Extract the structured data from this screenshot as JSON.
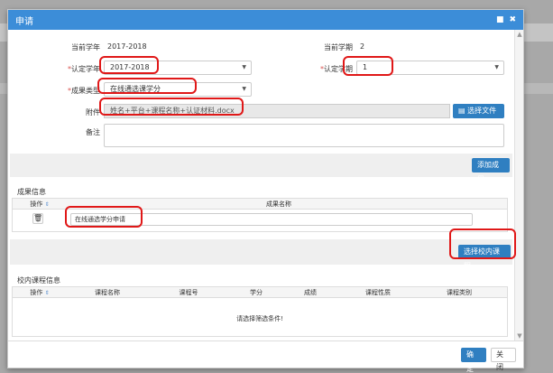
{
  "dialog": {
    "title": "申请",
    "min_label": "■",
    "close_label": "✖"
  },
  "form": {
    "current_year_label": "当前学年",
    "current_year_value": "2017-2018",
    "current_term_label": "当前学期",
    "current_term_value": "2",
    "cert_year_label": "认定学年",
    "cert_year_value": "2017-2018",
    "cert_term_label": "认定学期",
    "cert_term_value": "1",
    "type_label": "成果类型",
    "type_value": "在线通选课学分",
    "attach_label": "附件",
    "attach_value": "姓名+平台+课程名称+认证材料.docx",
    "select_file_label": "选择文件",
    "note_label": "备注",
    "required_mark": "*"
  },
  "add_result_label": "添加成果",
  "results": {
    "section_title": "成果信息",
    "col_op": "操作",
    "col_name": "成果名称",
    "rows": [
      {
        "name": "在线通选学分申请"
      }
    ]
  },
  "select_course_label": "选择校内课程",
  "courses": {
    "section_title": "校内课程信息",
    "columns": [
      "操作",
      "课程名称",
      "课程号",
      "学分",
      "成绩",
      "课程性质",
      "课程类别"
    ],
    "empty_text": "请选择筛选条件!"
  },
  "footer": {
    "ok_label": "确 定",
    "close_label": "关 闭"
  },
  "colors": {
    "titlebar": "#3c8dd8",
    "primary": "#2f7fc1",
    "annotation": "#e01818"
  }
}
